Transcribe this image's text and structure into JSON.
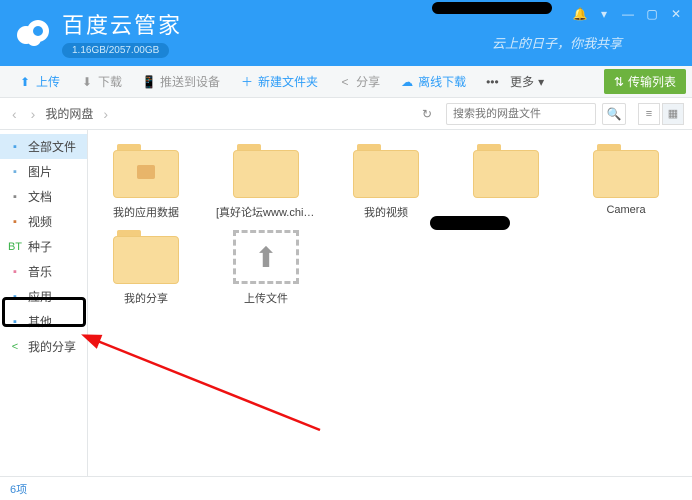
{
  "app": {
    "title": "百度云管家",
    "storage": "1.16GB/2057.00GB",
    "slogan": "云上的日子，你我共享"
  },
  "toolbar": {
    "upload": "上传",
    "download": "下载",
    "push": "推送到设备",
    "newfolder": "新建文件夹",
    "share": "分享",
    "offline": "离线下载",
    "more": "更多",
    "transfer": "传输列表"
  },
  "nav": {
    "breadcrumb": "我的网盘",
    "search_placeholder": "搜索我的网盘文件"
  },
  "sidebar": {
    "items": [
      {
        "label": "全部文件",
        "color": "#4aa3e8"
      },
      {
        "label": "图片",
        "color": "#6fb0e0"
      },
      {
        "label": "文档",
        "color": "#888"
      },
      {
        "label": "视频",
        "color": "#d27a3a"
      },
      {
        "label": "种子",
        "color": "#3bb24a",
        "prefix": "BT"
      },
      {
        "label": "音乐",
        "color": "#e87ea0"
      },
      {
        "label": "应用",
        "color": "#4aa3e8"
      },
      {
        "label": "其他",
        "color": "#4aa3e8"
      },
      {
        "label": "我的分享",
        "color": "#3bb24a"
      }
    ]
  },
  "files": {
    "items": [
      {
        "label": "我的应用数据",
        "type": "app"
      },
      {
        "label": "[真好论坛www.china...",
        "type": "folder"
      },
      {
        "label": "我的视频",
        "type": "folder"
      },
      {
        "label": "",
        "type": "folder"
      },
      {
        "label": "Camera",
        "type": "folder"
      },
      {
        "label": "我的分享",
        "type": "folder"
      },
      {
        "label": "上传文件",
        "type": "upload"
      }
    ]
  },
  "status": {
    "count": "6项"
  }
}
